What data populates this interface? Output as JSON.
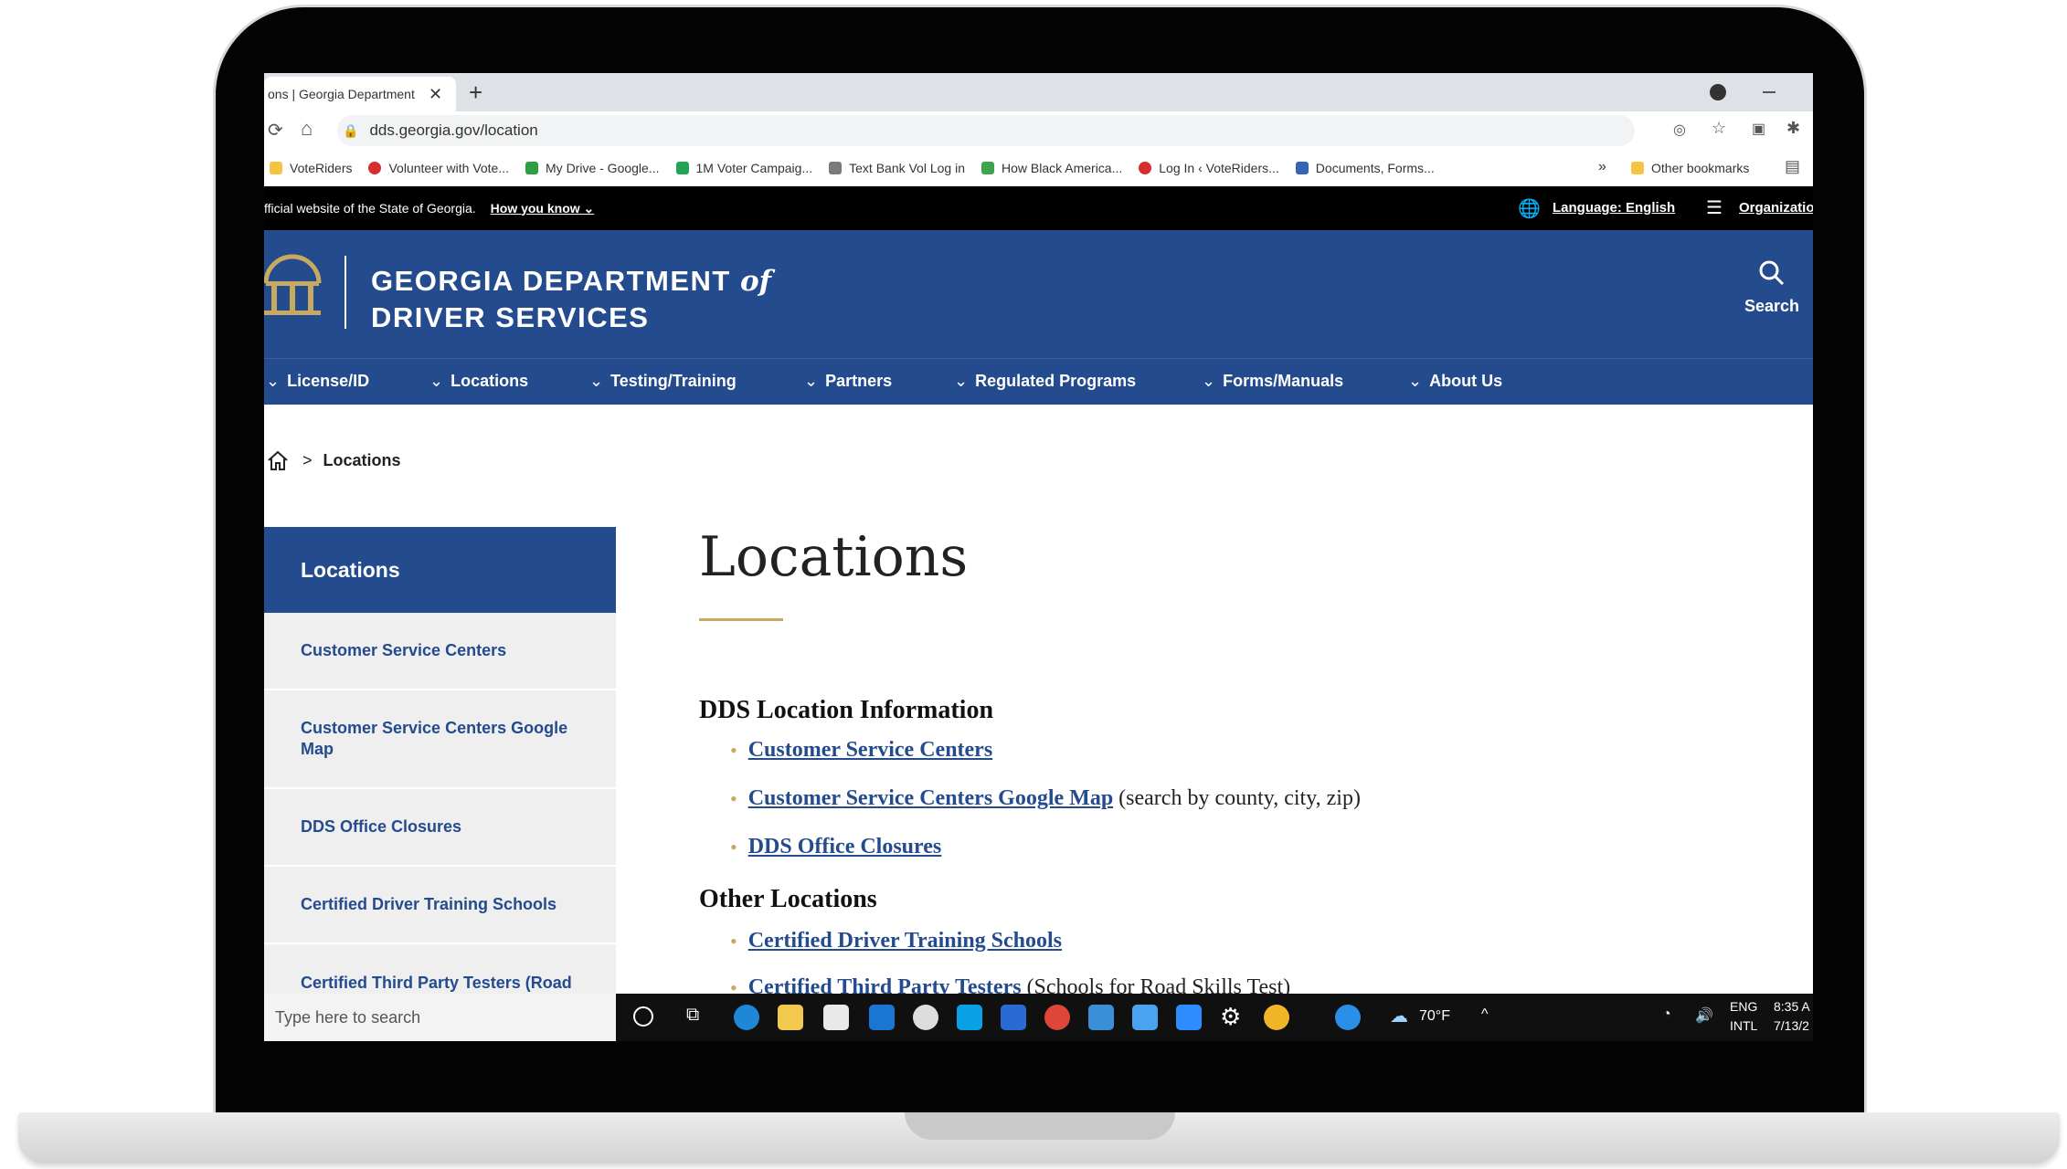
{
  "browser": {
    "tab_title": "ons | Georgia Department",
    "tab_close": "✕",
    "new_tab": "+",
    "url": "dds.georgia.gov/location",
    "bookmarks": [
      {
        "label": "VoteRiders",
        "color": "#f4c542"
      },
      {
        "label": "Volunteer with Vote...",
        "color": "#d62d2d"
      },
      {
        "label": "My Drive - Google...",
        "color": "#2f9e44"
      },
      {
        "label": "1M Voter Campaig...",
        "color": "#23a455"
      },
      {
        "label": "Text Bank Vol Log in",
        "color": "#7a7a7a"
      },
      {
        "label": "How Black America...",
        "color": "#3fa34d"
      },
      {
        "label": "Log In ‹ VoteRiders...",
        "color": "#d62d2d"
      },
      {
        "label": "Documents, Forms...",
        "color": "#3763b5"
      }
    ],
    "more_bookmarks": "»",
    "other_bookmarks": "Other bookmarks"
  },
  "site": {
    "official_text": "fficial website of the State of Georgia.",
    "how_you_know": "How you know",
    "language": "Language: English",
    "organization": "Organizatio",
    "title_line1": "GEORGIA DEPARTMENT",
    "title_of": "of",
    "title_line2": "DRIVER SERVICES",
    "search_label": "Search",
    "nav": [
      "License/ID",
      "Locations",
      "Testing/Training",
      "Partners",
      "Regulated Programs",
      "Forms/Manuals",
      "About Us"
    ],
    "breadcrumb_sep": ">",
    "breadcrumb_current": "Locations",
    "sidebar": {
      "title": "Locations",
      "items": [
        "Customer Service Centers",
        "Customer Service Centers Google Map",
        "DDS Office Closures",
        "Certified Driver Training Schools",
        "Certified Third Party Testers (Road"
      ]
    },
    "page_title": "Locations",
    "section1": {
      "heading": "DDS Location Information",
      "items": [
        {
          "link": "Customer Service Centers",
          "note": ""
        },
        {
          "link": "Customer Service Centers Google Map",
          "note": "(search by county, city, zip)"
        },
        {
          "link": "DDS Office Closures",
          "note": ""
        }
      ]
    },
    "section2": {
      "heading": "Other Locations",
      "items": [
        {
          "link": "Certified Driver Training Schools",
          "note": ""
        },
        {
          "link": "Certified Third Party Testers",
          "note": "(Schools for Road Skills Test)"
        }
      ]
    }
  },
  "taskbar": {
    "search_placeholder": "Type here to search",
    "weather": "70°F",
    "lang1": "ENG",
    "lang2": "INTL",
    "time": "8:35 A",
    "date": "7/13/2"
  },
  "colors": {
    "brand_blue": "#244b8d",
    "gold": "#c7a961"
  }
}
